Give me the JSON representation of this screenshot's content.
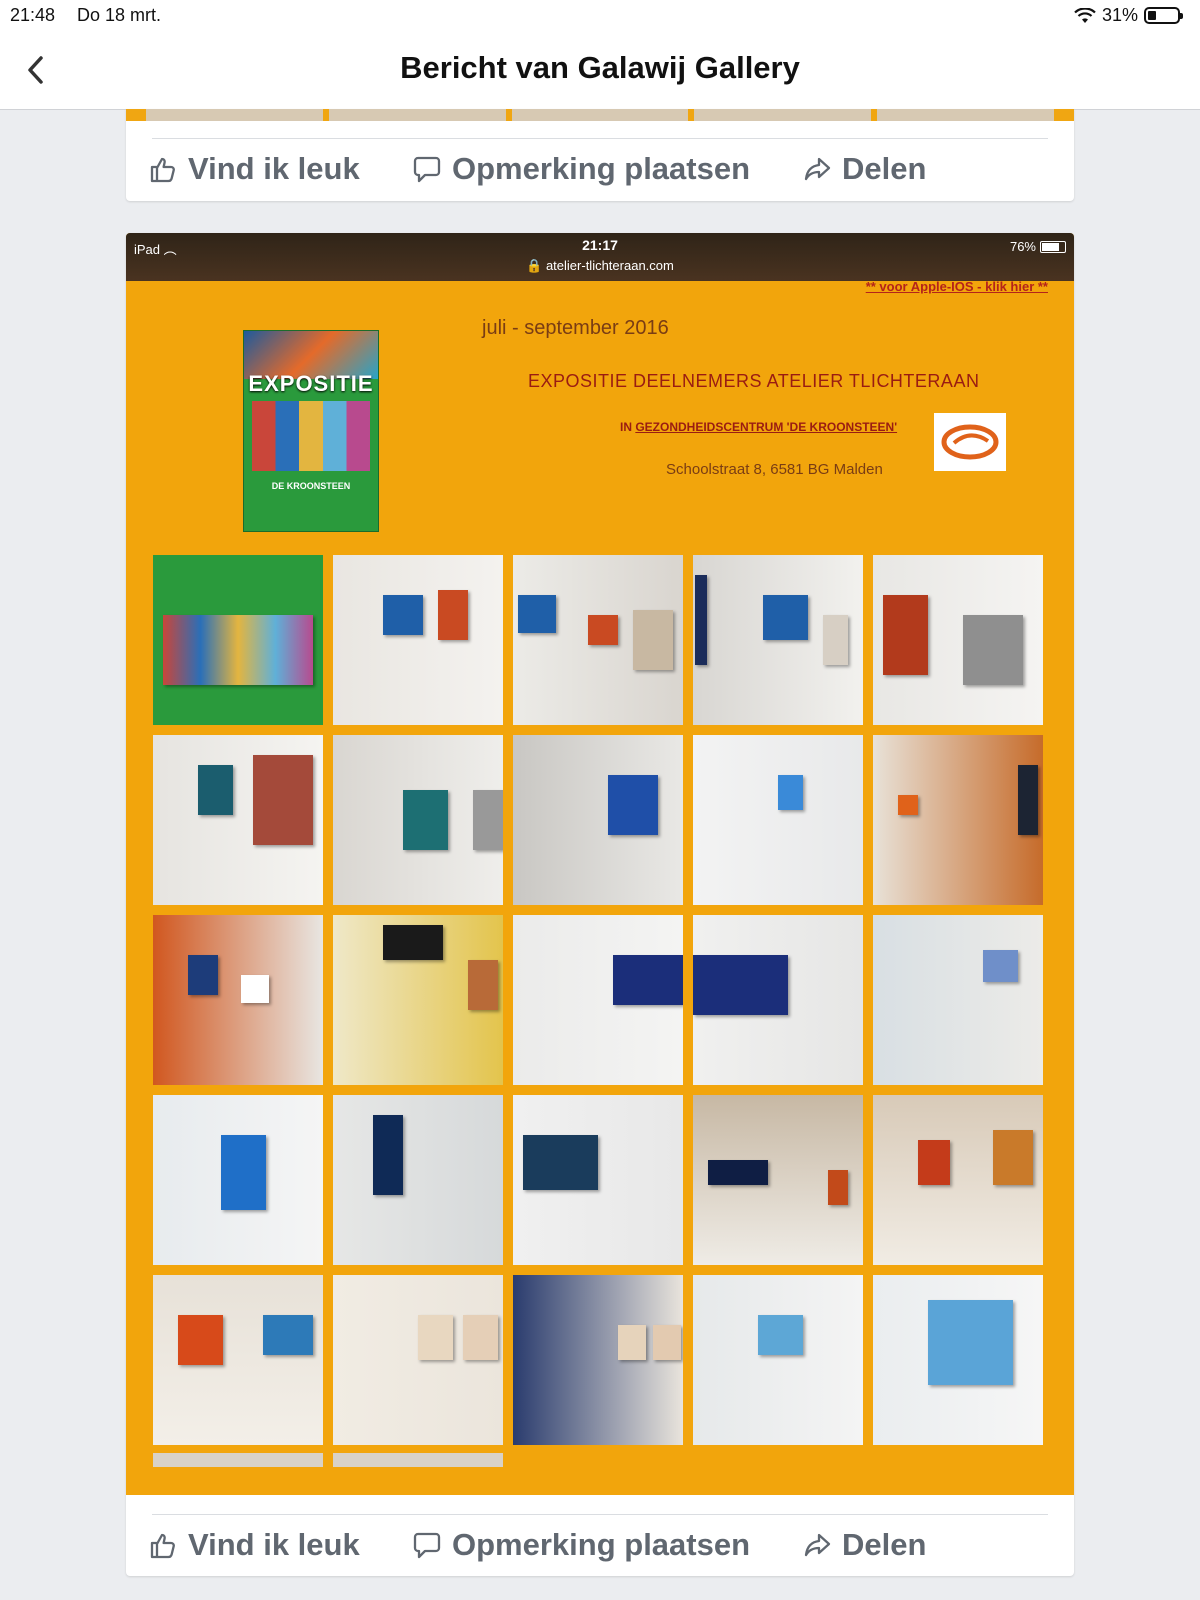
{
  "status_bar": {
    "time": "21:48",
    "date": "Do 18 mrt.",
    "battery": "31%"
  },
  "nav": {
    "title": "Bericht van Galawij Gallery"
  },
  "actions": {
    "like": "Vind ik leuk",
    "comment": "Opmerking plaatsen",
    "share": "Delen"
  },
  "screenshot": {
    "device": "iPad",
    "time": "21:17",
    "url": "atelier-tlichteraan.com",
    "battery": "76%",
    "apple_link": "** voor Apple-IOS  -  klik hier  **",
    "date_range": "juli - september 2016",
    "heading": "EXPOSITIE DEELNEMERS ATELIER TLICHTERAAN",
    "venue_prefix": "IN ",
    "venue_name": "GEZONDHEIDSCENTRUM 'DE KROONSTEEN'",
    "address": "Schoolstraat 8, 6581 BG Malden",
    "poster": {
      "title": "EXPOSITIE",
      "footer": "DE KROONSTEEN"
    }
  },
  "colors": {
    "accent_orange": "#f2a50c",
    "action_gray": "#606770",
    "heading_red": "#9a1c12"
  },
  "gallery_tiles": [
    "poster",
    "wall-diamond",
    "wall-diamond-2",
    "wall-diamond-3",
    "zebra",
    "zebra-hall",
    "stair-zebra",
    "stairs-sky",
    "stairs-white",
    "reception",
    "orange-wall",
    "yellow-room",
    "stairwell-fold",
    "fold-close",
    "door-room",
    "green-stripe",
    "stair-blue",
    "waterfall",
    "ceiling-lights",
    "waiting-room",
    "two-paintings",
    "coatrack",
    "corridor",
    "blossom-1",
    "blossom-2"
  ]
}
